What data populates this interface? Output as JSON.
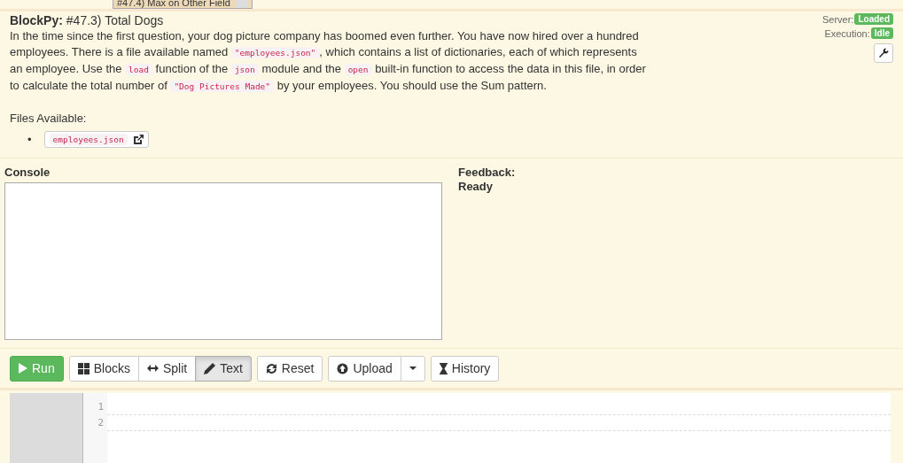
{
  "problem_selector": {
    "value": "#47.4) Max on Other Field"
  },
  "header": {
    "brand": "BlockPy:",
    "title": "#47.3) Total Dogs"
  },
  "description": [
    {
      "kind": "text",
      "text": "In the time since the first question, your dog picture company has boomed even further. You have now hired over a hundred employees. There is a file available named "
    },
    {
      "kind": "code",
      "text": "\"employees.json\""
    },
    {
      "kind": "text",
      "text": ", which contains a list of dictionaries, each of which represents an employee. Use the "
    },
    {
      "kind": "code",
      "text": "load"
    },
    {
      "kind": "text",
      "text": " function of the "
    },
    {
      "kind": "code",
      "text": "json"
    },
    {
      "kind": "text",
      "text": " module and the "
    },
    {
      "kind": "code",
      "text": "open"
    },
    {
      "kind": "text",
      "text": " built-in function to access the data in this file, in order to calculate the total number of "
    },
    {
      "kind": "code",
      "text": "\"Dog Pictures Made\""
    },
    {
      "kind": "text",
      "text": " by your employees. You should use the Sum pattern."
    }
  ],
  "files_label": "Files Available:",
  "files": [
    {
      "bullet": "•",
      "name": "employees.json"
    }
  ],
  "status": {
    "server_label": "Server:",
    "server": "Loaded",
    "execution_label": "Execution:",
    "execution": "Idle"
  },
  "console": {
    "label": "Console"
  },
  "feedback": {
    "label": "Feedback:",
    "message": "Ready"
  },
  "toolbar": {
    "run": "Run",
    "modes": [
      {
        "kind": "blocks",
        "label": "Blocks",
        "selected": false
      },
      {
        "kind": "split",
        "label": "Split",
        "selected": false
      },
      {
        "kind": "text",
        "label": "Text",
        "selected": true
      }
    ],
    "reset": "Reset",
    "upload": "Upload",
    "history": "History"
  },
  "editor": {
    "line_numbers": [
      "1",
      "2"
    ]
  }
}
